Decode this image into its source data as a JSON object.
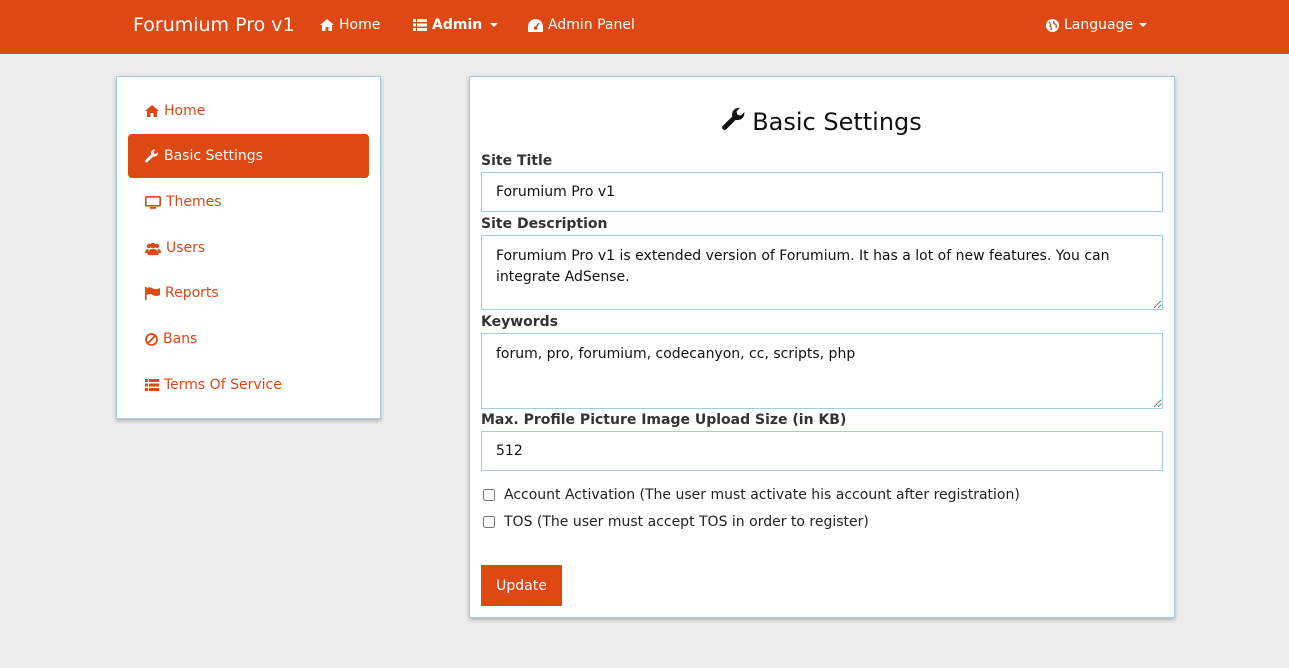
{
  "navbar": {
    "brand": "Forumium Pro v1",
    "home": "Home",
    "admin": "Admin",
    "admin_panel": "Admin Panel",
    "language": "Language",
    "color": "#dd4814"
  },
  "sidebar": {
    "items": [
      {
        "label": "Home",
        "icon": "home-icon"
      },
      {
        "label": "Basic Settings",
        "icon": "wrench-icon",
        "active": true
      },
      {
        "label": "Themes",
        "icon": "monitor-icon"
      },
      {
        "label": "Users",
        "icon": "users-icon"
      },
      {
        "label": "Reports",
        "icon": "flag-icon"
      },
      {
        "label": "Bans",
        "icon": "ban-icon"
      },
      {
        "label": "Terms Of Service",
        "icon": "list-icon"
      }
    ]
  },
  "settings": {
    "title": "Basic Settings",
    "site_title_label": "Site Title",
    "site_title_value": "Forumium Pro v1",
    "site_description_label": "Site Description",
    "site_description_value": "Forumium Pro v1 is extended version of Forumium. It has a lot of new features. You can integrate AdSense.",
    "keywords_label": "Keywords",
    "keywords_value": "forum, pro, forumium, codecanyon, cc, scripts, php",
    "upload_size_label": "Max. Profile Picture Image Upload Size (in KB)",
    "upload_size_value": "512",
    "account_activation_label": "Account Activation (The user must activate his account after registration)",
    "account_activation_checked": false,
    "tos_label": "TOS (The user must accept TOS in order to register)",
    "tos_checked": false,
    "update_button": "Update"
  }
}
